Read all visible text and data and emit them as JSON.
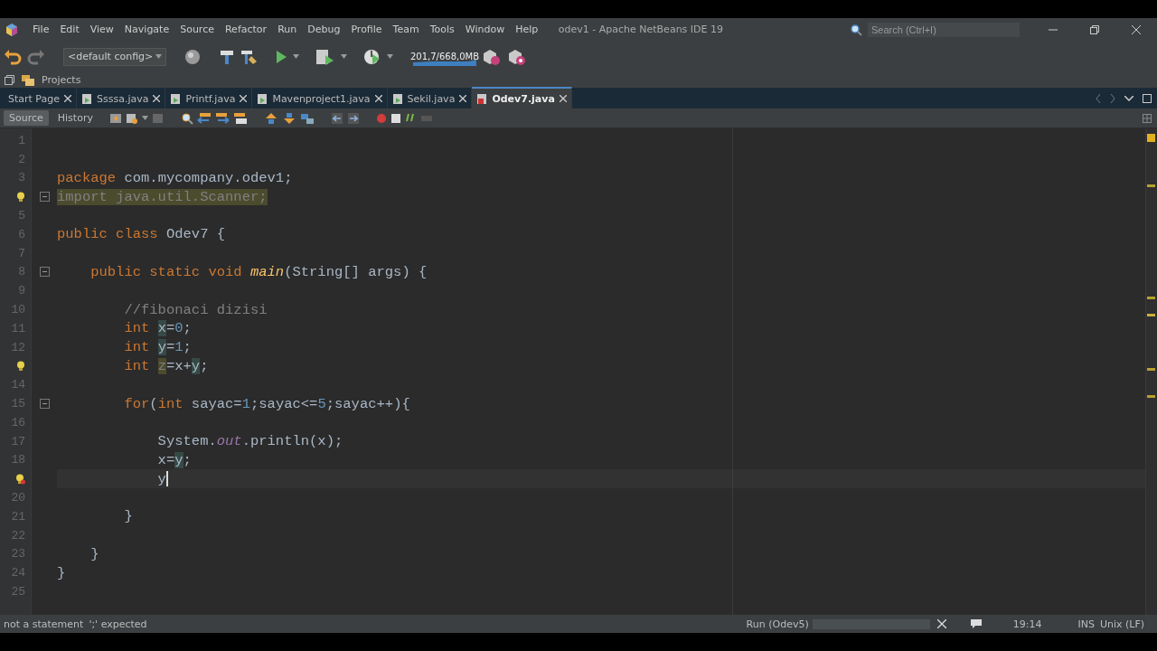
{
  "window": {
    "title": "odev1 - Apache NetBeans IDE 19"
  },
  "menu": [
    "File",
    "Edit",
    "View",
    "Navigate",
    "Source",
    "Refactor",
    "Run",
    "Debug",
    "Profile",
    "Team",
    "Tools",
    "Window",
    "Help"
  ],
  "search": {
    "placeholder": "Search (Ctrl+I)"
  },
  "toolbar": {
    "config": "<default config>",
    "memory": "201,7/668,0MB"
  },
  "projects_tab": {
    "label": "Projects"
  },
  "editor_tabs": [
    {
      "label": "Start Page",
      "selected": false,
      "kind": "page"
    },
    {
      "label": "Ssssa.java",
      "selected": false,
      "kind": "java"
    },
    {
      "label": "Printf.java",
      "selected": false,
      "kind": "java"
    },
    {
      "label": "Mavenproject1.java",
      "selected": false,
      "kind": "java"
    },
    {
      "label": "Sekil.java",
      "selected": false,
      "kind": "java"
    },
    {
      "label": "Odev7.java",
      "selected": true,
      "kind": "java-error"
    }
  ],
  "editor_views": [
    {
      "label": "Source",
      "selected": true
    },
    {
      "label": "History",
      "selected": false
    }
  ],
  "code": {
    "lines": [
      {
        "kind": "numbered",
        "number": "1",
        "fold": false,
        "current": false
      },
      {
        "kind": "numbered",
        "number": "2",
        "fold": false,
        "current": false
      },
      {
        "kind": "numbered",
        "number": "3",
        "fold": false,
        "current": false,
        "tokens": [
          {
            "text": "package",
            "kind": "keyword"
          },
          {
            "text": " com.mycompany.odev1;",
            "kind": "plain"
          }
        ]
      },
      {
        "kind": "hint",
        "fold": true,
        "current": false,
        "tokens": [
          {
            "text": "import java.util.Scanner;",
            "kind": "unused"
          }
        ]
      },
      {
        "kind": "numbered",
        "number": "5",
        "fold": false,
        "current": false
      },
      {
        "kind": "numbered",
        "number": "6",
        "fold": false,
        "current": false,
        "tokens": [
          {
            "text": "public class",
            "kind": "keyword"
          },
          {
            "text": " Odev7 {",
            "kind": "plain"
          }
        ]
      },
      {
        "kind": "numbered",
        "number": "7",
        "fold": false,
        "current": false
      },
      {
        "kind": "numbered",
        "number": "8",
        "fold": true,
        "current": false,
        "tokens": [
          {
            "text": "    public static void ",
            "kind": "keyword"
          },
          {
            "text": "main",
            "kind": "method"
          },
          {
            "text": "(String[] args) {",
            "kind": "plain"
          }
        ]
      },
      {
        "kind": "numbered",
        "number": "9",
        "fold": false,
        "current": false
      },
      {
        "kind": "numbered",
        "number": "10",
        "fold": false,
        "current": false,
        "tokens": [
          {
            "text": "        //fibonaci dizisi",
            "kind": "comment"
          }
        ]
      },
      {
        "kind": "numbered",
        "number": "11",
        "fold": false,
        "current": false,
        "tokens": [
          {
            "text": "        int ",
            "kind": "keyword"
          },
          {
            "text": "x",
            "kind": "marked"
          },
          {
            "text": "=",
            "kind": "plain"
          },
          {
            "text": "0",
            "kind": "number"
          },
          {
            "text": ";",
            "kind": "plain"
          }
        ]
      },
      {
        "kind": "numbered",
        "number": "12",
        "fold": false,
        "current": false,
        "tokens": [
          {
            "text": "        int ",
            "kind": "keyword"
          },
          {
            "text": "y",
            "kind": "marked"
          },
          {
            "text": "=",
            "kind": "plain"
          },
          {
            "text": "1",
            "kind": "number"
          },
          {
            "text": ";",
            "kind": "plain"
          }
        ]
      },
      {
        "kind": "hint",
        "fold": false,
        "current": false,
        "tokens": [
          {
            "text": "        int ",
            "kind": "keyword"
          },
          {
            "text": "z",
            "kind": "unused"
          },
          {
            "text": "=x+",
            "kind": "plain"
          },
          {
            "text": "y",
            "kind": "marked"
          },
          {
            "text": ";",
            "kind": "plain"
          }
        ]
      },
      {
        "kind": "numbered",
        "number": "14",
        "fold": false,
        "current": false
      },
      {
        "kind": "numbered",
        "number": "15",
        "fold": true,
        "current": false,
        "tokens": [
          {
            "text": "        for",
            "kind": "keyword"
          },
          {
            "text": "(",
            "kind": "plain"
          },
          {
            "text": "int",
            "kind": "keyword"
          },
          {
            "text": " sayac=",
            "kind": "plain"
          },
          {
            "text": "1",
            "kind": "number"
          },
          {
            "text": ";sayac<=",
            "kind": "plain"
          },
          {
            "text": "5",
            "kind": "number"
          },
          {
            "text": ";sayac++){",
            "kind": "plain"
          }
        ]
      },
      {
        "kind": "numbered",
        "number": "16",
        "fold": false,
        "current": false
      },
      {
        "kind": "numbered",
        "number": "17",
        "fold": false,
        "current": false,
        "tokens": [
          {
            "text": "            System.",
            "kind": "plain"
          },
          {
            "text": "out",
            "kind": "field"
          },
          {
            "text": ".println(x);",
            "kind": "plain"
          }
        ]
      },
      {
        "kind": "numbered",
        "number": "18",
        "fold": false,
        "current": false,
        "tokens": [
          {
            "text": "            x=",
            "kind": "plain"
          },
          {
            "text": "y",
            "kind": "marked"
          },
          {
            "text": ";",
            "kind": "plain"
          }
        ]
      },
      {
        "kind": "error",
        "fold": false,
        "current": true,
        "tokens": [
          {
            "text": "            y",
            "kind": "plain"
          }
        ]
      },
      {
        "kind": "numbered",
        "number": "20",
        "fold": false,
        "current": false
      },
      {
        "kind": "numbered",
        "number": "21",
        "fold": false,
        "current": false,
        "tokens": [
          {
            "text": "        }",
            "kind": "plain"
          }
        ]
      },
      {
        "kind": "numbered",
        "number": "22",
        "fold": false,
        "current": false
      },
      {
        "kind": "numbered",
        "number": "23",
        "fold": false,
        "current": false,
        "tokens": [
          {
            "text": "    }",
            "kind": "plain"
          }
        ]
      },
      {
        "kind": "numbered",
        "number": "24",
        "fold": false,
        "current": false,
        "tokens": [
          {
            "text": "}",
            "kind": "plain"
          }
        ]
      },
      {
        "kind": "numbered",
        "number": "25",
        "fold": false,
        "current": false
      }
    ]
  },
  "status_bar": {
    "messages": [
      "not a statement",
      "';' expected"
    ],
    "task": "Run (Odev5)",
    "caret": "19:14",
    "mode": "INS",
    "line_endings": "Unix (LF)"
  }
}
